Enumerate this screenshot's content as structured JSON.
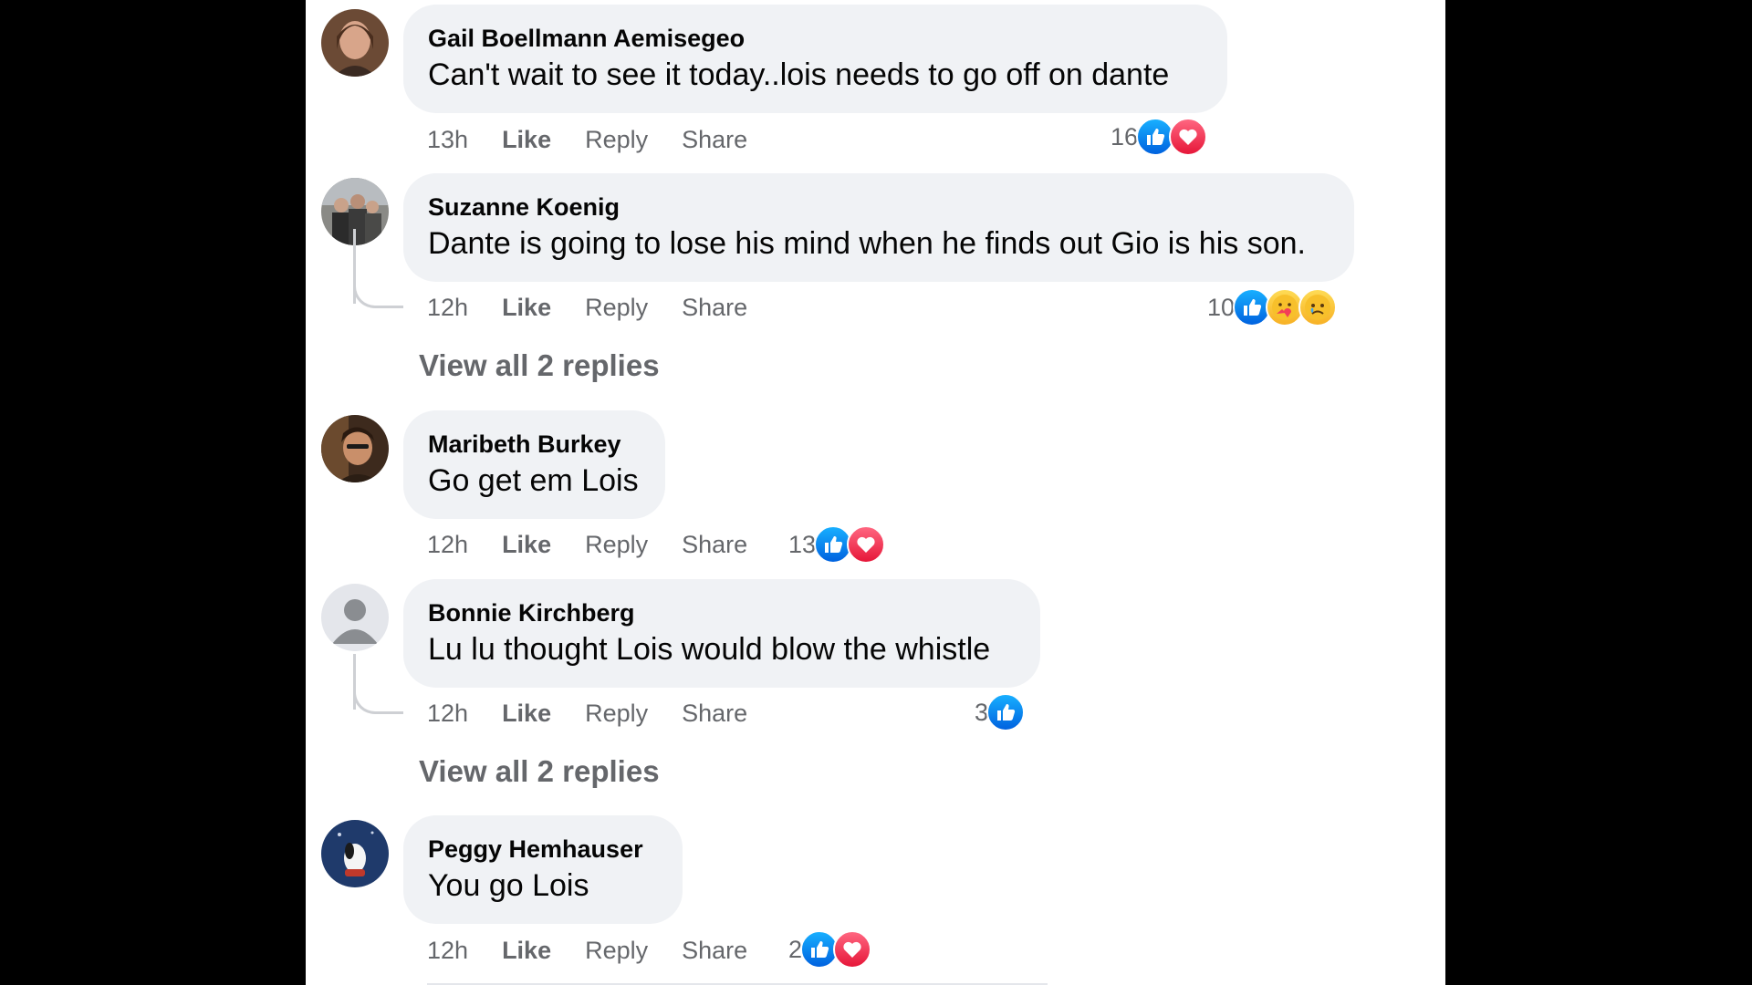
{
  "action_labels": {
    "like": "Like",
    "reply": "Reply",
    "share": "Share"
  },
  "comments": [
    {
      "author": "Gail Boellmann Aemisegeo",
      "text": "Can't wait to see it today..lois needs to go off on dante",
      "time": "13h",
      "reaction_count": "16",
      "reactions": [
        "like",
        "love"
      ],
      "avatar": "woman-portrait-avatar"
    },
    {
      "author": "Suzanne Koenig",
      "text": "Dante is going to lose his mind when he finds out Gio is his son.",
      "time": "12h",
      "reaction_count": "10",
      "reactions": [
        "like",
        "care",
        "sad"
      ],
      "avatar": "group-photo-avatar",
      "view_replies": "View all 2 replies"
    },
    {
      "author": "Maribeth Burkey",
      "text": "Go get em Lois",
      "time": "12h",
      "reaction_count": "13",
      "reactions": [
        "like",
        "love"
      ],
      "avatar": "man-portrait-avatar"
    },
    {
      "author": "Bonnie Kirchberg",
      "text": "Lu lu thought Lois would blow the whistle",
      "time": "12h",
      "reaction_count": "3",
      "reactions": [
        "like"
      ],
      "avatar": "default-user-avatar",
      "view_replies": "View all 2 replies"
    },
    {
      "author": "Peggy Hemhauser",
      "text": "You go Lois",
      "time": "12h",
      "reaction_count": "2",
      "reactions": [
        "like",
        "love"
      ],
      "avatar": "snoopy-avatar"
    }
  ],
  "colors": {
    "bubble": "#f0f2f5",
    "secondary_text": "#65676b",
    "like_blue": "#1877f2",
    "love_red": "#f33e58"
  }
}
